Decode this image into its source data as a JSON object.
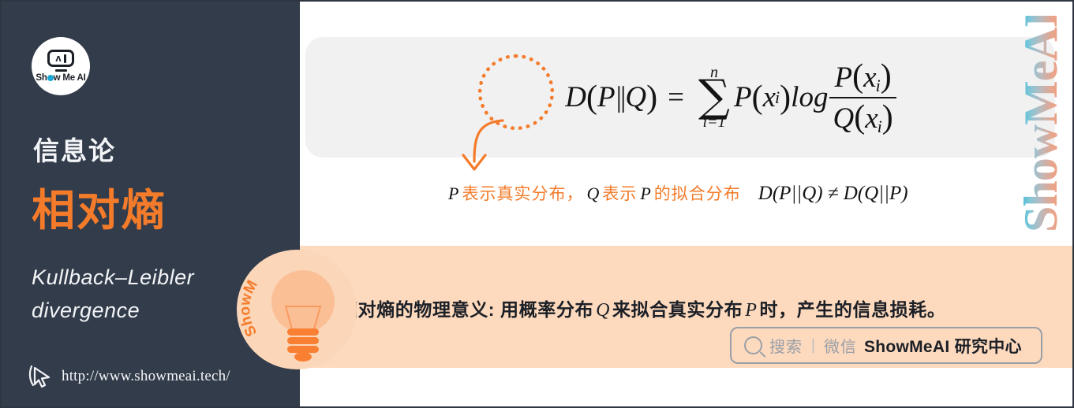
{
  "sidebar": {
    "logo": {
      "icon": "showmeai-robot-logo",
      "caret": "ʌ",
      "text_pre": "Sh",
      "text_dot": "o",
      "text_post": "w Me AI"
    },
    "kicker": "信息论",
    "title": "相对熵",
    "subtitle": "Kullback–Leibler divergence",
    "url": "http://www.showmeai.tech/",
    "cursor_icon": "mouse-pointer-icon",
    "bg_color": "#333c4a",
    "accent_color": "#f47b2a"
  },
  "formula": {
    "panel_bg": "#f1f1f1",
    "lhs_D": "D",
    "lhs_open": "(",
    "lhs_P": "P",
    "lhs_bars": "||",
    "lhs_Q": "Q",
    "lhs_close": ")",
    "equals": "=",
    "sum_upper": "n",
    "sum_symbol": "∑",
    "sum_lower": "i=1",
    "term_P": "P",
    "term_open": "(",
    "term_x": "x",
    "term_i": "i",
    "term_close": ")",
    "log": "log",
    "frac_num_P": "P",
    "frac_num_open": "(",
    "frac_num_x": "x",
    "frac_num_i": "i",
    "frac_num_close": ")",
    "frac_den_Q": "Q",
    "frac_den_open": "(",
    "frac_den_x": "x",
    "frac_den_i": "i",
    "frac_den_close": ")",
    "highlight_circle": "dotted-circle-highlight",
    "arrow": "curved-down-arrow"
  },
  "note": {
    "var_P": "P",
    "text_1": "表示真实分布，",
    "var_Q": "Q",
    "text_2": "表示",
    "var_P2": "P",
    "text_3": "的拟合分布",
    "inequality": "D(P||Q) ≠ D(Q||P)",
    "color": "#f47b2a"
  },
  "banner": {
    "bg_color": "#fdd9bd",
    "text_1": "相对熵的物理意义: 用概率分布",
    "var_Q": "Q",
    "text_2": "来拟合真实分布",
    "var_P": "P",
    "text_3": "时，产生的信息损耗。",
    "badge": {
      "icon": "lightbulb-icon",
      "curved_text": "ShowMeAI"
    },
    "search": {
      "icon": "search-icon",
      "placeholder": "搜索",
      "separator": "|",
      "channel": "微信",
      "brand": "ShowMeAI 研究中心"
    }
  },
  "watermark": {
    "text": "ShowMeAI",
    "color_top": "#27b6d6",
    "color_mid": "#b6bbc0",
    "color_bottom": "#ef9a7a"
  }
}
